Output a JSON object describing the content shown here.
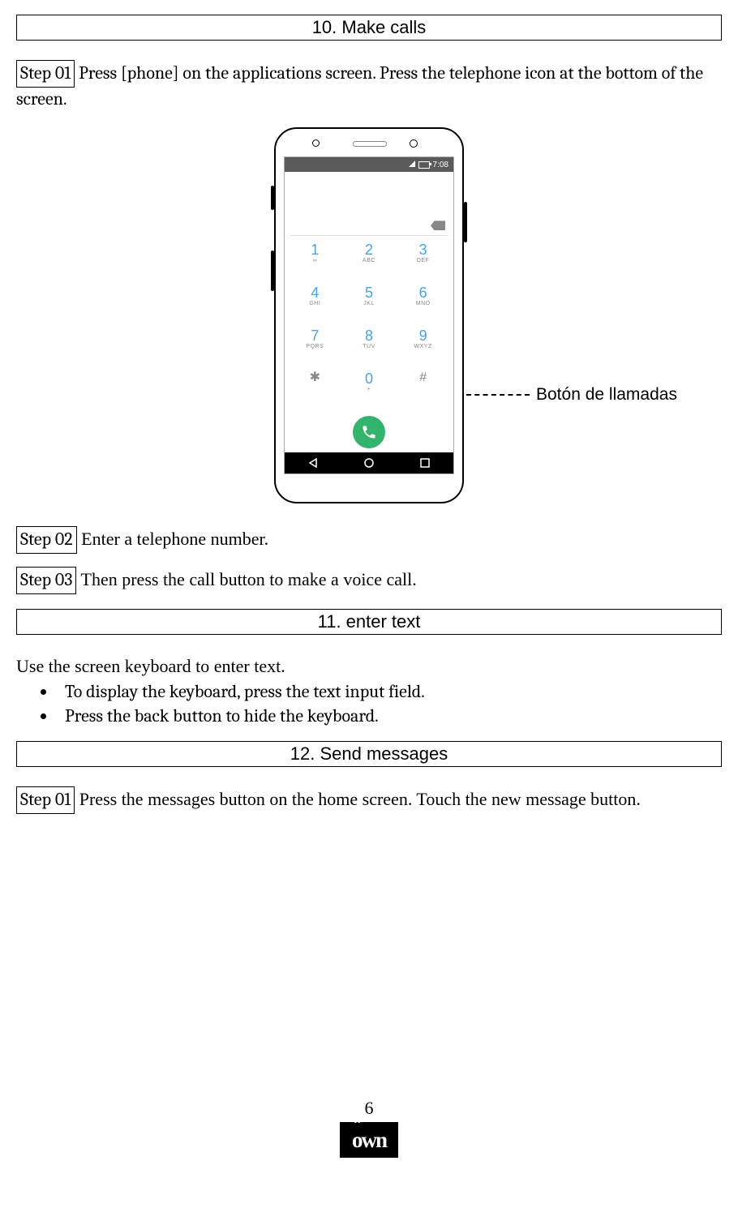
{
  "section10": {
    "title": "10. Make calls",
    "step1_label": "Step 01",
    "step1_text": " Press [phone] on the applications screen. Press the telephone icon at the bottom of the screen.",
    "step2_label": "Step 02",
    "step2_text": " Enter a telephone number.",
    "step3_label": "Step 03",
    "step3_text": " Then press the call button to make a voice call."
  },
  "phone": {
    "status_time": "7:08",
    "annotation": "Botón de llamadas",
    "keys": [
      {
        "num": "1",
        "sub": "∞"
      },
      {
        "num": "2",
        "sub": "ABC"
      },
      {
        "num": "3",
        "sub": "DEF"
      },
      {
        "num": "4",
        "sub": "GHI"
      },
      {
        "num": "5",
        "sub": "JKL"
      },
      {
        "num": "6",
        "sub": "MNO"
      },
      {
        "num": "7",
        "sub": "PQRS"
      },
      {
        "num": "8",
        "sub": "TUV"
      },
      {
        "num": "9",
        "sub": "WXYZ"
      },
      {
        "num": "✱",
        "sub": ""
      },
      {
        "num": "0",
        "sub": "+"
      },
      {
        "num": "#",
        "sub": ""
      }
    ]
  },
  "section11": {
    "title": "11. enter text",
    "intro": "Use the screen keyboard to enter text.",
    "bullets": [
      "To display the keyboard, press the text input field.",
      "Press the back button to hide the keyboard."
    ]
  },
  "section12": {
    "title": "12. Send messages",
    "step1_label": "Step 01",
    "step1_text": " Press the messages button on the home screen. Touch the new message button."
  },
  "footer": {
    "page_number": "6",
    "logo_text": "own"
  }
}
